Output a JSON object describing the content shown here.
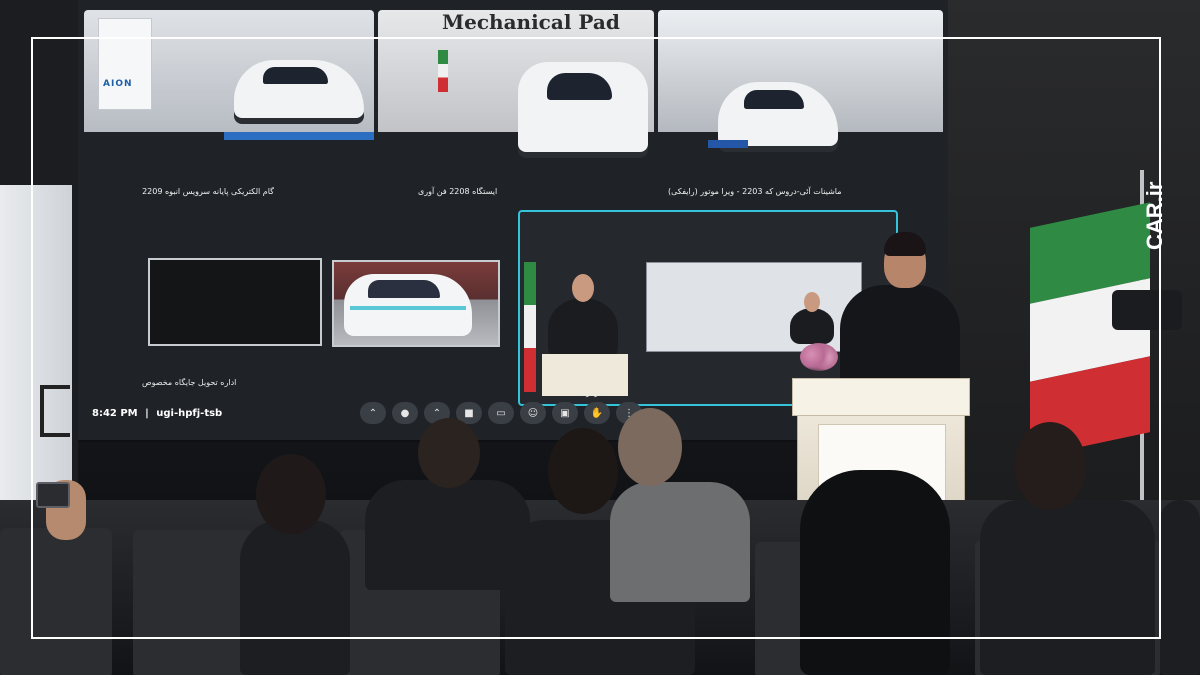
{
  "screen": {
    "feeds": [
      {
        "id": "feed-1",
        "sign": "AION",
        "caption": "گام الکتریکی پایانه سرویس انبوه 2209"
      },
      {
        "id": "feed-2",
        "header": "Mechanical Pad",
        "caption": "ایستگاه 2208 فن آوری"
      },
      {
        "id": "feed-3",
        "caption": "ماشینات آئی-دروس که 2203 - ویرا موتور (رایفکی)"
      }
    ],
    "tile_label": "اداره تحویل جایگاه مخصوص",
    "speaker_tile_label": "مرکزی",
    "meet": {
      "time": "8:42 PM",
      "separator": "|",
      "code": "ugi-hpfj-tsb"
    }
  },
  "watermark": "CAR.ir",
  "colors": {
    "accent_cyan": "#34c3d9",
    "end_call_red": "#e0413a",
    "flag_green": "#2f8a44",
    "flag_red": "#cf2e32",
    "frame": "#ffffff"
  },
  "icons": [
    "chevron-up-icon",
    "mic-icon",
    "camera-icon",
    "present-icon",
    "emoji-icon",
    "captions-icon",
    "raise-hand-icon",
    "more-icon",
    "end-call-icon"
  ]
}
